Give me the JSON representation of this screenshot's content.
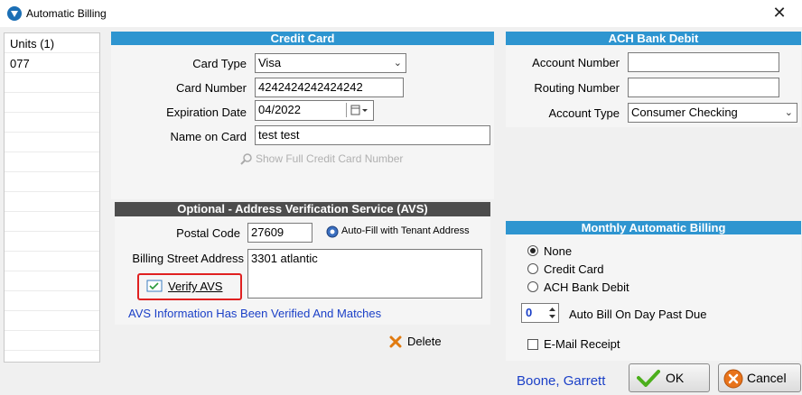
{
  "window": {
    "title": "Automatic Billing",
    "close_glyph": "✕"
  },
  "units": {
    "header": "Units (1)",
    "items": [
      "077"
    ]
  },
  "credit_card": {
    "header": "Credit Card",
    "card_type_label": "Card Type",
    "card_type_value": "Visa",
    "card_number_label": "Card Number",
    "card_number_value": "4242424242424242",
    "expiration_label": "Expiration Date",
    "expiration_value": "04/2022",
    "name_label": "Name on Card",
    "name_value": "test test",
    "show_full_label": "Show Full Credit Card Number"
  },
  "avs": {
    "header": "Optional - Address Verification Service (AVS)",
    "postal_label": "Postal Code",
    "postal_value": "27609",
    "autofill_label": "Auto-Fill with Tenant Address",
    "street_label": "Billing Street Address",
    "street_value": "3301 atlantic",
    "verify_label": "Verify AVS",
    "status_text": "AVS Information Has Been Verified And Matches",
    "highlight_color": "#e02020"
  },
  "delete_label": "Delete",
  "ach": {
    "header": "ACH Bank Debit",
    "account_number_label": "Account Number",
    "account_number_value": "",
    "routing_label": "Routing Number",
    "routing_value": "",
    "account_type_label": "Account Type",
    "account_type_value": "Consumer Checking"
  },
  "monthly": {
    "header": "Monthly Automatic Billing",
    "options": [
      "None",
      "Credit Card",
      "ACH Bank Debit"
    ],
    "selected": "None",
    "auto_bill_day": "0",
    "auto_bill_label": "Auto Bill On Day Past Due",
    "email_label": "E-Mail Receipt",
    "email_checked": false
  },
  "footer": {
    "tenant_name": "Boone, Garrett",
    "ok_label": "OK",
    "cancel_label": "Cancel"
  },
  "colors": {
    "accent": "#2e95d0",
    "gray_header": "#4d4d4d",
    "link_blue": "#1a3fc7"
  }
}
